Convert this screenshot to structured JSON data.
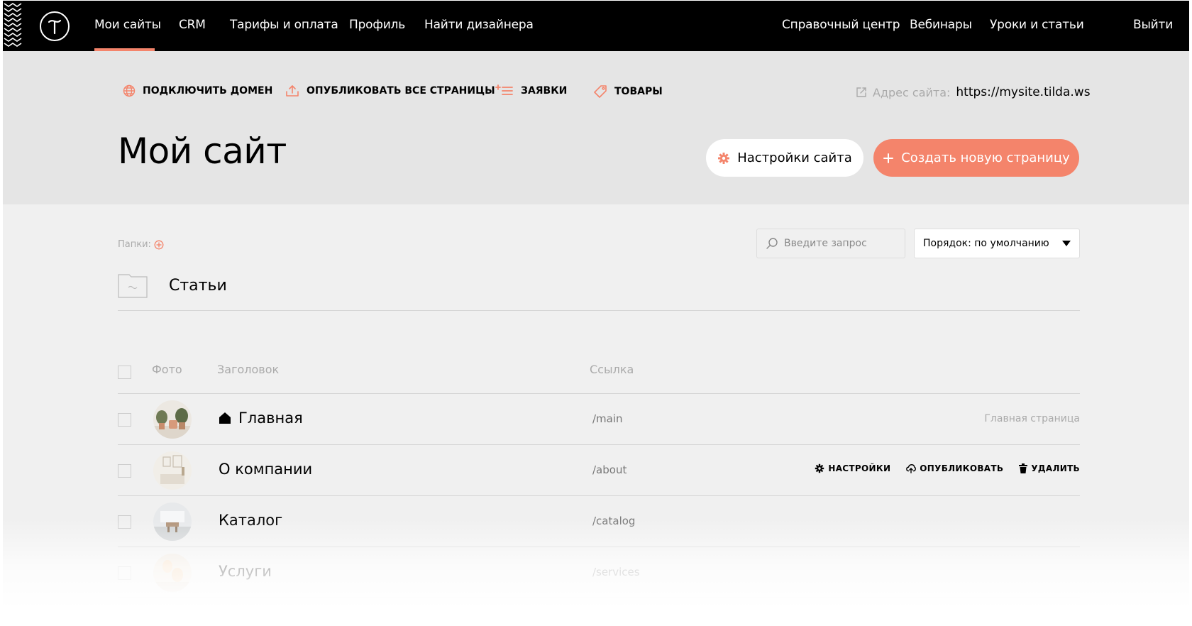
{
  "nav": {
    "left": [
      "Мои сайты",
      "CRM",
      "Тарифы и оплата",
      "Профиль",
      "Найти дизайнера"
    ],
    "right": [
      "Справочный центр",
      "Вебинары",
      "Уроки и статьи",
      "Выйти"
    ],
    "active": "Мои сайты"
  },
  "toolbar": {
    "connect_domain": "ПОДКЛЮЧИТЬ ДОМЕН",
    "publish_all": "ОПУБЛИКОВАТЬ ВСЕ СТРАНИЦЫ",
    "leads": "ЗАЯВКИ",
    "products": "ТОВАРЫ",
    "address_label": "Адрес сайта:",
    "address_url": "https://mysite.tilda.ws"
  },
  "hero": {
    "title": "Мой сайт",
    "settings_button": "Настройки сайта",
    "create_button": "Создать новую страницу"
  },
  "filters": {
    "folders_label": "Папки:",
    "search_placeholder": "Введите запрос",
    "sort_value": "Порядок: по умолчанию"
  },
  "folder": {
    "name": "Статьи"
  },
  "table": {
    "headers": {
      "photo": "Фото",
      "title": "Заголовок",
      "link": "Ссылка"
    },
    "rows": [
      {
        "title": "Главная",
        "link": "/main",
        "note": "Главная страница",
        "home": true
      },
      {
        "title": "О компании",
        "link": "/about",
        "actions": [
          "НАСТРОЙКИ",
          "ОПУБЛИКОВАТЬ",
          "УДАЛИТЬ"
        ]
      },
      {
        "title": "Каталог",
        "link": "/catalog"
      },
      {
        "title": "Услуги",
        "link": "/services"
      }
    ]
  },
  "colors": {
    "accent": "#f4846b",
    "topbar": "#000000",
    "hero_bg": "#e5e5e5",
    "page_bg": "#f0f0f0"
  }
}
